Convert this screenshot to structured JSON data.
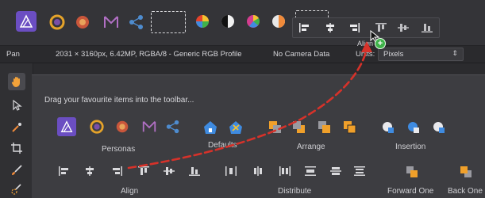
{
  "colors": {
    "affinity_purple": "#6b4ec2",
    "accent_orange": "#f0a02a",
    "accent_blue": "#3f8be0",
    "drag_arrow_red": "#d6322a",
    "add_badge_green": "#3fb34a"
  },
  "toolbar": {
    "icons": [
      "affinity-logo-icon",
      "photo-persona-icon",
      "develop-persona-icon",
      "tone-mapping-persona-icon",
      "export-persona-icon",
      "color-wheel-icon",
      "black-white-icon",
      "hsl-icon",
      "white-balance-icon"
    ],
    "align_popup_label": "Align"
  },
  "context_bar": {
    "tool_name": "Pan",
    "document_info": "2031 × 3160px, 6.42MP, RGBA/8 - Generic RGB Profile",
    "camera_info": "No Camera Data",
    "units_label": "Units:",
    "units_value": "Pixels"
  },
  "tools": [
    "hand-tool-icon",
    "move-tool-icon",
    "color-picker-tool-icon",
    "crop-tool-icon",
    "brush-tool-icon",
    "selection-brush-tool-icon"
  ],
  "customize": {
    "instruction": "Drag your favourite items into the toolbar...",
    "groups": {
      "personas": "Personas",
      "defaults": "Defaults",
      "arrange": "Arrange",
      "insertion": "Insertion",
      "align": "Align",
      "distribute": "Distribute",
      "forward_one": "Forward One",
      "back_one": "Back One"
    }
  }
}
